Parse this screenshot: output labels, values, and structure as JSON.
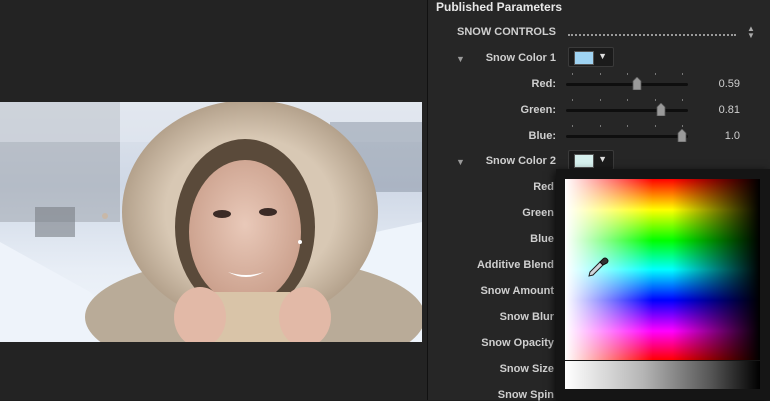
{
  "inspector": {
    "title": "Published Parameters",
    "group_label": "SNOW CONTROLS",
    "snow_color_1": {
      "label": "Snow Color 1",
      "swatch_color": "#9fd3f2",
      "red": {
        "label": "Red:",
        "value": "0.59",
        "level": 0.59
      },
      "green": {
        "label": "Green:",
        "value": "0.81",
        "level": 0.81
      },
      "blue": {
        "label": "Blue:",
        "value": "1.0",
        "level": 1.0
      }
    },
    "snow_color_2": {
      "label": "Snow Color 2",
      "swatch_color": "#d7f1ef"
    },
    "hidden_rows": [
      {
        "label": "Red"
      },
      {
        "label": "Green"
      },
      {
        "label": "Blue"
      },
      {
        "label": "Additive Blend"
      },
      {
        "label": "Snow Amount"
      },
      {
        "label": "Snow Blur"
      },
      {
        "label": "Snow Opacity"
      },
      {
        "label": "Snow Size"
      },
      {
        "label": "Snow Spin"
      }
    ]
  },
  "colors": {
    "panel_bg": "#262626",
    "viewer_bg": "#232323",
    "text": "#cfcfcf"
  },
  "icons": {
    "disclosure": "triangle-down-icon",
    "dropdown": "chevron-down-icon",
    "stepper": "up-down-arrows-icon",
    "eyedropper": "eyedropper-icon"
  }
}
